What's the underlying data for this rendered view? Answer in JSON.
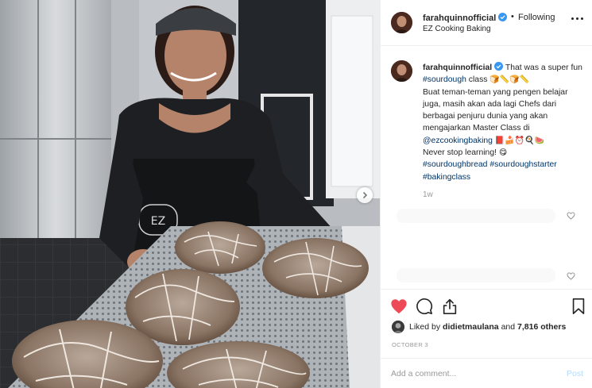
{
  "post": {
    "username": "farahquinnofficial",
    "follow_status": "Following",
    "separator": "•",
    "location": "EZ Cooking Baking",
    "icons": {
      "verified": "verified-badge-icon",
      "more": "more-options-icon",
      "next": "chevron-right-icon"
    },
    "colors": {
      "accent_link": "#003569",
      "like_red": "#ed4956",
      "verified_blue": "#3897f0",
      "post_disabled": "#b3dbff"
    }
  },
  "caption": {
    "username": "farahquinnofficial",
    "line1_text": "That was a super fun",
    "hashtag_sourdough": "#sourdough",
    "line1_after": "class",
    "emoji_bread_1": "🍞📏🍞📏",
    "body": "Buat teman-teman yang pengen belajar juga, masih akan ada lagi Chefs dari berbagai penjuru dunia yang akan mengajarkan Master Class di",
    "mention": "@ezcookingbaking",
    "emoji_2": "📕🍰⏰🍳🍉",
    "closing": "Never stop learning!",
    "emoji_3": "😋",
    "hashtags": [
      "#sourdoughbread",
      "#sourdoughstarter",
      "#bakingclass"
    ],
    "time_ago": "1w"
  },
  "likes": {
    "prefix": "Liked by",
    "user": "didietmaulana",
    "connector": "and",
    "count": "7,816 others"
  },
  "date": "OCTOBER 3",
  "comment_box": {
    "placeholder": "Add a comment...",
    "post_label": "Post"
  }
}
